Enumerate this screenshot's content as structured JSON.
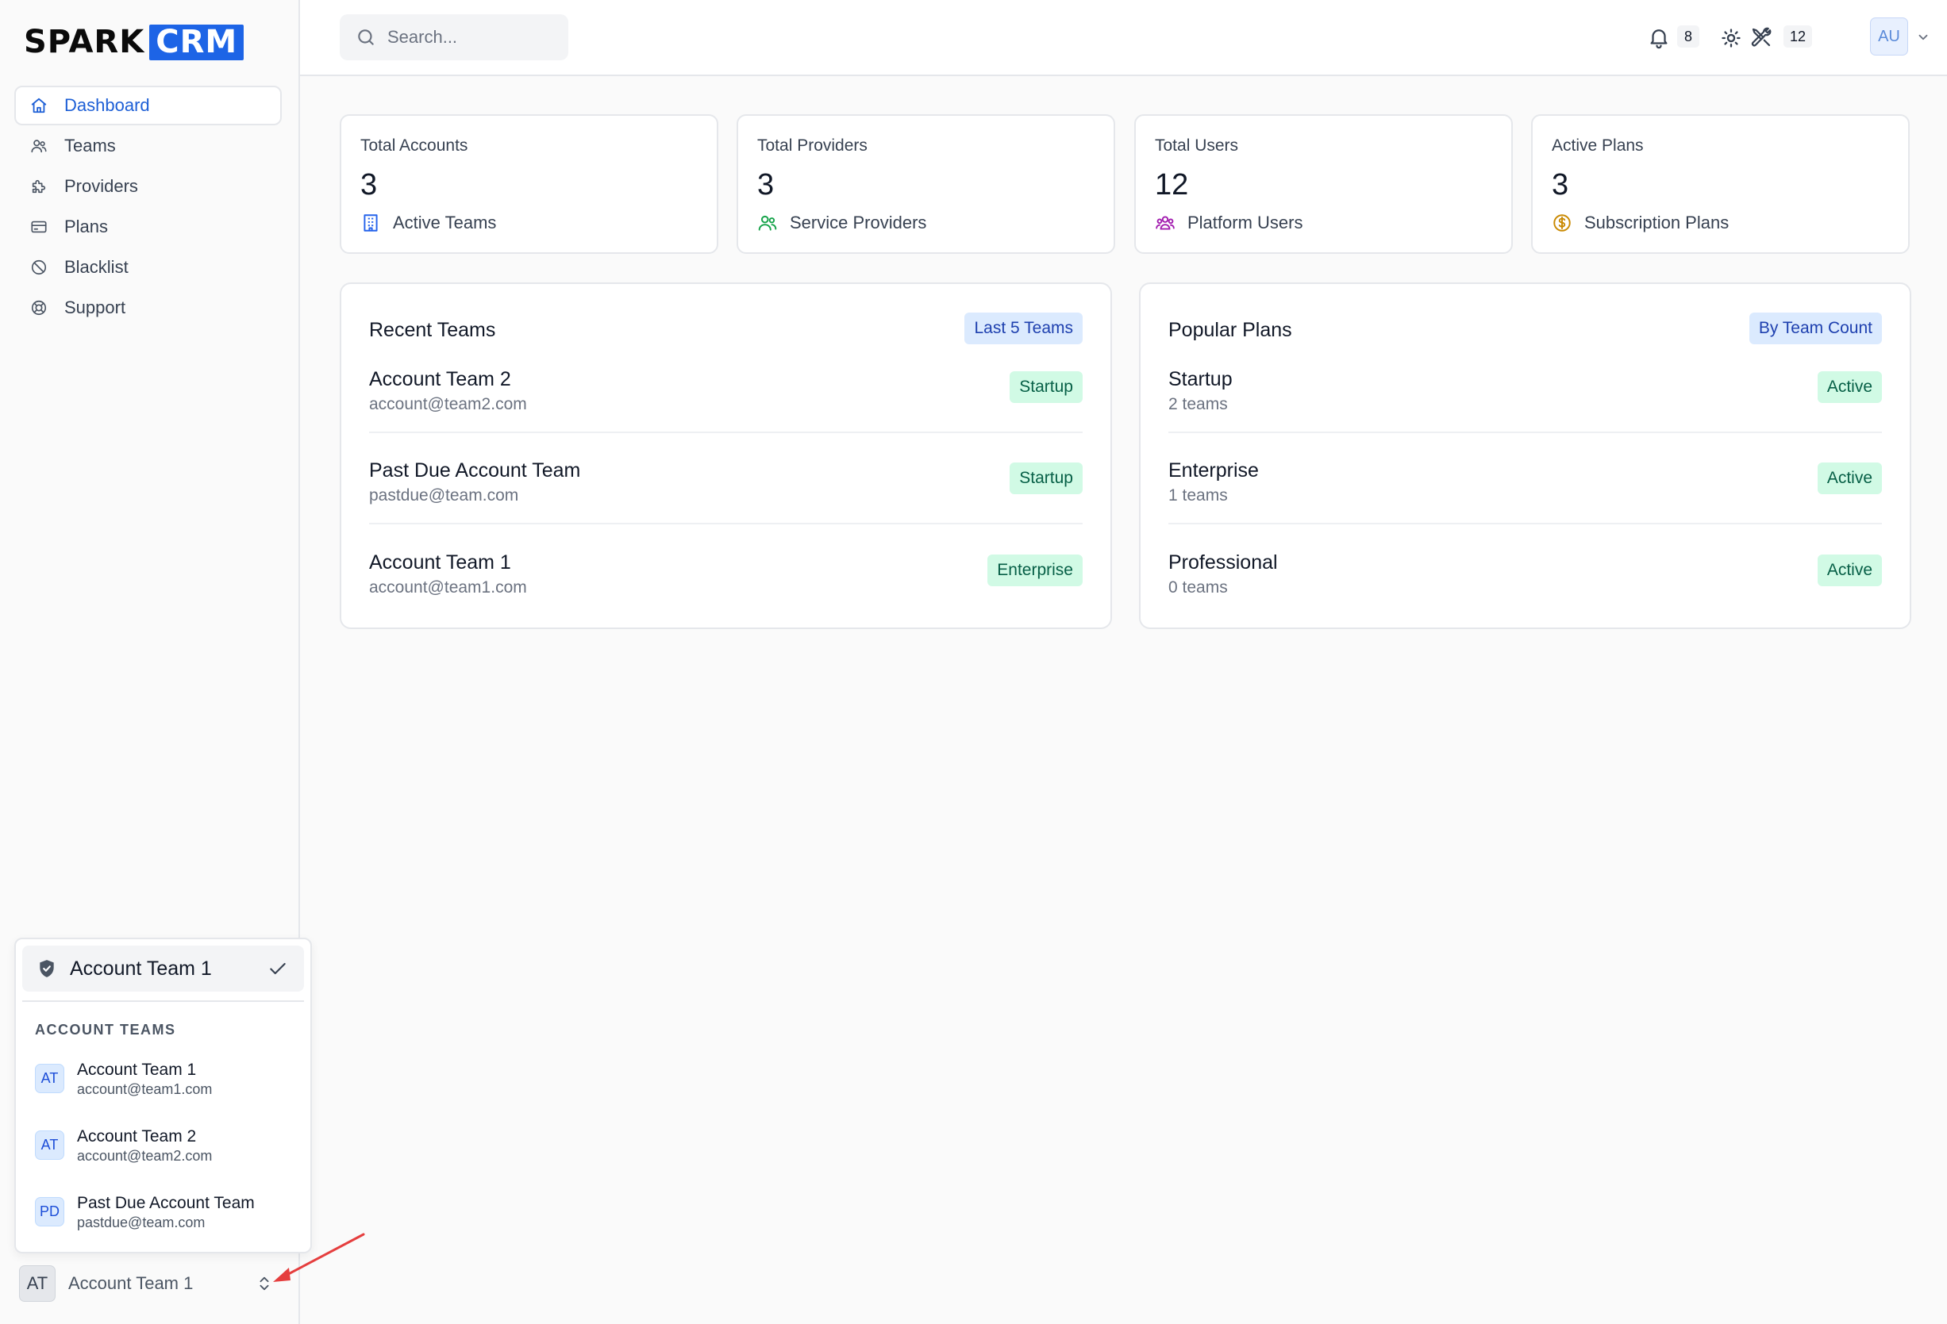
{
  "brand": {
    "part1": "SPARK",
    "part2": "CRM"
  },
  "nav": [
    {
      "label": "Dashboard",
      "icon": "home-icon",
      "active": true
    },
    {
      "label": "Teams",
      "icon": "users-icon"
    },
    {
      "label": "Providers",
      "icon": "puzzle-icon"
    },
    {
      "label": "Plans",
      "icon": "credit-card-icon"
    },
    {
      "label": "Blacklist",
      "icon": "ban-icon"
    },
    {
      "label": "Support",
      "icon": "lifebuoy-icon"
    }
  ],
  "search": {
    "placeholder": "Search..."
  },
  "topbar": {
    "notifications_count": "8",
    "tools_count": "12",
    "avatar": "AU"
  },
  "stats": [
    {
      "title": "Total Accounts",
      "value": "3",
      "sub": "Active Teams",
      "icon": "building-icon",
      "color": "#2563eb"
    },
    {
      "title": "Total Providers",
      "value": "3",
      "sub": "Service Providers",
      "icon": "users-icon",
      "color": "#16a34a"
    },
    {
      "title": "Total Users",
      "value": "12",
      "sub": "Platform Users",
      "icon": "user-group-icon",
      "color": "#a21caf"
    },
    {
      "title": "Active Plans",
      "value": "3",
      "sub": "Subscription Plans",
      "icon": "dollar-icon",
      "color": "#ca8a04"
    }
  ],
  "recent_teams": {
    "title": "Recent Teams",
    "tag": "Last 5 Teams",
    "rows": [
      {
        "name": "Account Team 2",
        "sub": "account@team2.com",
        "badge": "Startup"
      },
      {
        "name": "Past Due Account Team",
        "sub": "pastdue@team.com",
        "badge": "Startup"
      },
      {
        "name": "Account Team 1",
        "sub": "account@team1.com",
        "badge": "Enterprise"
      }
    ]
  },
  "popular_plans": {
    "title": "Popular Plans",
    "tag": "By Team Count",
    "rows": [
      {
        "name": "Startup",
        "sub": "2 teams",
        "badge": "Active"
      },
      {
        "name": "Enterprise",
        "sub": "1 teams",
        "badge": "Active"
      },
      {
        "name": "Professional",
        "sub": "0 teams",
        "badge": "Active"
      }
    ]
  },
  "team_menu": {
    "current": "Account Team 1",
    "heading": "ACCOUNT TEAMS",
    "options": [
      {
        "initials": "AT",
        "name": "Account Team 1",
        "email": "account@team1.com"
      },
      {
        "initials": "AT",
        "name": "Account Team 2",
        "email": "account@team2.com"
      },
      {
        "initials": "PD",
        "name": "Past Due Account Team",
        "email": "pastdue@team.com"
      }
    ]
  },
  "team_switcher": {
    "initials": "AT",
    "label": "Account Team 1"
  },
  "colors": {
    "accent": "#1d64e6",
    "annotation_arrow": "#e53e3e"
  }
}
